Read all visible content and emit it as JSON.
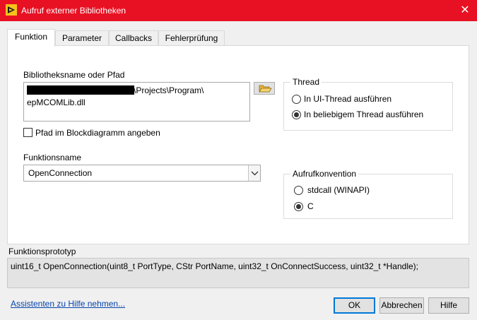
{
  "window": {
    "title": "Aufruf externer Bibliotheken",
    "close_icon": "close-icon"
  },
  "tabs": [
    {
      "label": "Funktion",
      "active": true
    },
    {
      "label": "Parameter",
      "active": false
    },
    {
      "label": "Callbacks",
      "active": false
    },
    {
      "label": "Fehlerprüfung",
      "active": false
    }
  ],
  "library": {
    "label": "Bibliotheksname oder Pfad",
    "path_line1_visible": "\\Projects\\Program\\",
    "path_line2": "epMCOMLib.dll",
    "browse_icon": "folder-open-icon",
    "checkbox_label": "Pfad im Blockdiagramm angeben",
    "checkbox_checked": false
  },
  "function": {
    "label": "Funktionsname",
    "value": "OpenConnection"
  },
  "thread": {
    "title": "Thread",
    "options": [
      {
        "label": "In UI-Thread ausführen",
        "selected": false
      },
      {
        "label": "In beliebigem Thread ausführen",
        "selected": true
      }
    ]
  },
  "convention": {
    "title": "Aufrufkonvention",
    "options": [
      {
        "label": "stdcall (WINAPI)",
        "selected": false
      },
      {
        "label": "C",
        "selected": true
      }
    ]
  },
  "prototype": {
    "label": "Funktionsprototyp",
    "text": "uint16_t OpenConnection(uint8_t PortType, CStr PortName, uint32_t OnConnectSuccess, uint32_t *Handle);"
  },
  "footer": {
    "help_link": "Assistenten zu Hilfe nehmen...",
    "ok": "OK",
    "cancel": "Abbrechen",
    "help": "Hilfe"
  },
  "colors": {
    "titlebar": "#e81123",
    "default_button_border": "#0078d7",
    "link": "#0645ad"
  }
}
